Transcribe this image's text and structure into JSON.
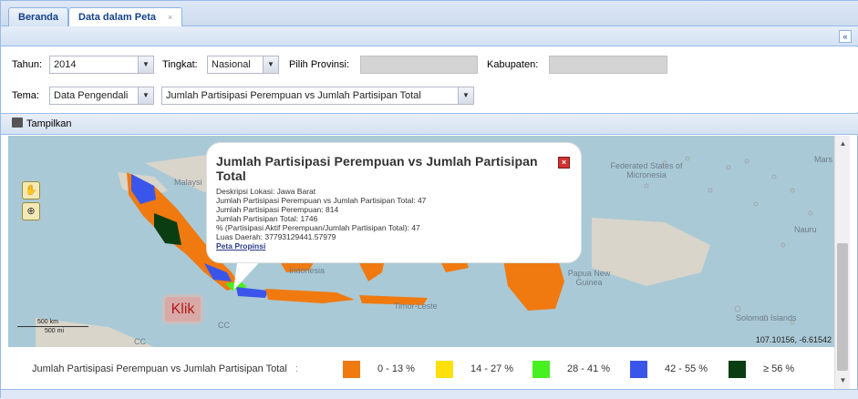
{
  "tabs": [
    {
      "label": "Beranda",
      "active": false
    },
    {
      "label": "Data dalam Peta",
      "active": true,
      "close": "×"
    }
  ],
  "collapse_icon": "«",
  "filters": {
    "tahun_label": "Tahun:",
    "tahun_value": "2014",
    "tingkat_label": "Tingkat:",
    "tingkat_value": "Nasional",
    "provinsi_label": "Pilih Provinsi:",
    "kabupaten_label": "Kabupaten:",
    "tema_label": "Tema:",
    "tema_value": "Data Pengendali",
    "indikator_value": "Jumlah Partisipasi Perempuan vs Jumlah Partisipan Total"
  },
  "toolbar": {
    "tampilkan_label": "Tampilkan"
  },
  "map": {
    "labels": {
      "malaysia": "Malaysi",
      "indonesia": "Indonesia",
      "timor": "Timor-Leste",
      "micronesia": "Federated States of Micronesia",
      "png": "Papua New Guinea",
      "nauru": "Nauru",
      "marshall": "Mars",
      "solomon": "Solomon Islands",
      "cc": "CC"
    },
    "scale_km": "500 km",
    "scale_mi": "500 mi",
    "coordinates": "107.10156, -6.61542",
    "pan_icon": "hand-icon",
    "zoom_icon": "zoom-box-icon"
  },
  "popup": {
    "title": "Jumlah Partisipasi Perempuan vs Jumlah Partisipan Total",
    "lines": [
      "Deskripsi Lokasi: Jawa Barat",
      "Jumlah Partisipasi Perempuan vs Jumlah Partisipan Total: 47",
      "Jumlah Partisipasi Perempuan: 814",
      "Jumlah Partisipan Total: 1746",
      "% (Partisipasi Aktif Perempuan/Jumlah Partisipan Total): 47",
      "Luas Daerah: 37793129441.57979"
    ],
    "link": "Peta Propinsi",
    "close": "×"
  },
  "callout": "Klik",
  "legend": {
    "title": "Jumlah Partisipasi Perempuan vs Jumlah Partisipan Total",
    "separator": ":",
    "items": [
      {
        "label": "0 - 13 %",
        "color": "#f07a10"
      },
      {
        "label": "14 - 27 %",
        "color": "#ffe00a"
      },
      {
        "label": "28 - 41 %",
        "color": "#47f020"
      },
      {
        "label": "42 - 55 %",
        "color": "#3a56ea"
      },
      {
        "label": "≥ 56 %",
        "color": "#0b3d12"
      }
    ]
  }
}
